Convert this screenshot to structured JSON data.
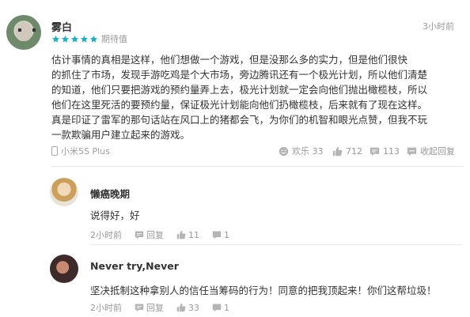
{
  "review": {
    "username": "雾白",
    "timestamp": "3小时前",
    "rating": 5,
    "rating_max": 5,
    "rating_label": "期待值",
    "body_lines": [
      "估计事情的真相是这样，他们想做一个游戏，但是没那么多的实力，但是他们很快",
      "的抓住了市场，发现手游吃鸡是个大市场，旁边腾讯还有一个极光计划，所以他们清楚",
      "的知道，他们只要把游戏的预约量弄上去，极光计划就一定会向他们抛出橄榄枝，所以",
      "他们在这里死活的要预约量，保证极光计划能向他们扔橄榄枝，后来就有了现在这样。",
      "真是印证了雷军的那句话站在风口上的猪都会飞，为你们的机智和眼光点赞，但我不玩",
      "一款欺骗用户建立起来的游戏。"
    ],
    "device": "小米5S Plus",
    "actions": {
      "happy_label": "欢乐 33",
      "like_count": "712",
      "comment_count": "113",
      "collapse_label": "收起回复"
    }
  },
  "replies": [
    {
      "username": "懒癌晚期",
      "text": "说得好，好",
      "time": "2小时前",
      "reply_label": "回复",
      "like_count": "11",
      "comment_count": "1"
    },
    {
      "username": "Never try,Never",
      "text": "坚决抵制这种拿别人的信任当筹码的行为！同意的把我顶起来！你们这帮垃圾！",
      "time": "2小时前",
      "reply_label": "回复",
      "like_count": "33",
      "comment_count": "1"
    }
  ],
  "colors": {
    "star": "#16b0c4",
    "muted_text": "#999999",
    "body_text": "#333333"
  },
  "icons": {
    "rating": "star-icon",
    "device": "phone-icon",
    "happy": "smile-icon",
    "like": "thumbs-up-icon",
    "comment": "comment-bubble-icon",
    "collapse": "collapse-bubble-icon"
  }
}
